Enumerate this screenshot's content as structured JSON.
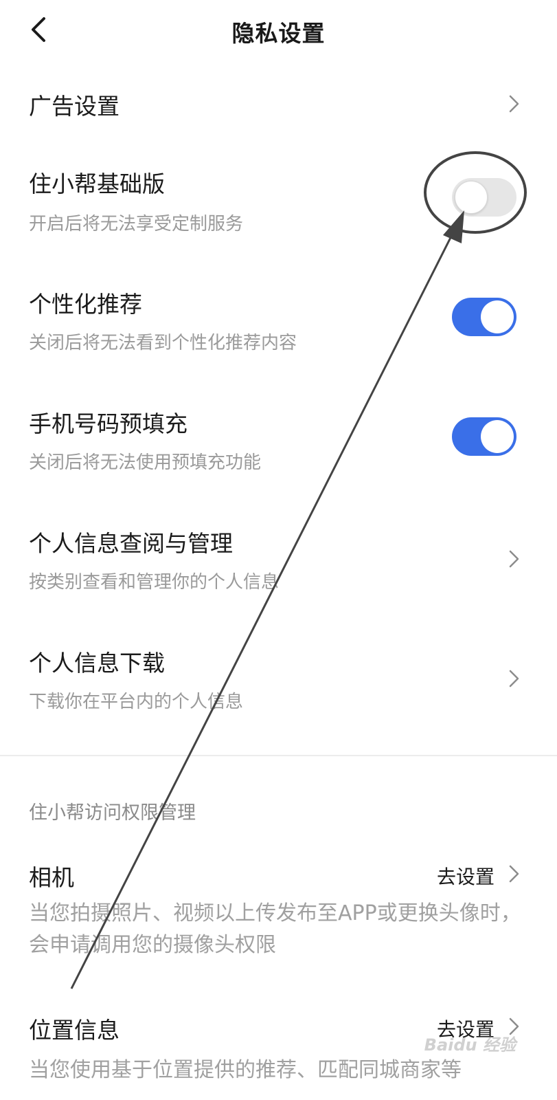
{
  "header": {
    "title": "隐私设置",
    "back_icon": "chevron-left-icon"
  },
  "settings": {
    "ad": {
      "title": "广告设置"
    },
    "basic": {
      "title": "住小帮基础版",
      "desc": "开启后将无法享受定制服务",
      "enabled": false
    },
    "personalized": {
      "title": "个性化推荐",
      "desc": "关闭后将无法看到个性化推荐内容",
      "enabled": true
    },
    "phone_prefill": {
      "title": "手机号码预填充",
      "desc": "关闭后将无法使用预填充功能",
      "enabled": true
    },
    "info_manage": {
      "title": "个人信息查阅与管理",
      "desc": "按类别查看和管理你的个人信息"
    },
    "info_download": {
      "title": "个人信息下载",
      "desc": "下载你在平台内的个人信息"
    }
  },
  "permissions": {
    "section_title": "住小帮访问权限管理",
    "camera": {
      "title": "相机",
      "action": "去设置",
      "desc": "当您拍摄照片、视频以上传发布至APP或更换头像时，会申请调用您的摄像头权限"
    },
    "location": {
      "title": "位置信息",
      "action": "去设置",
      "desc": "当您使用基于位置提供的推荐、匹配同城商家等"
    }
  },
  "watermark": "Baidu 经验",
  "colors": {
    "accent": "#3a6fe8",
    "toggle_off": "#e6e6e6",
    "secondary_text": "#9a9a9a"
  }
}
